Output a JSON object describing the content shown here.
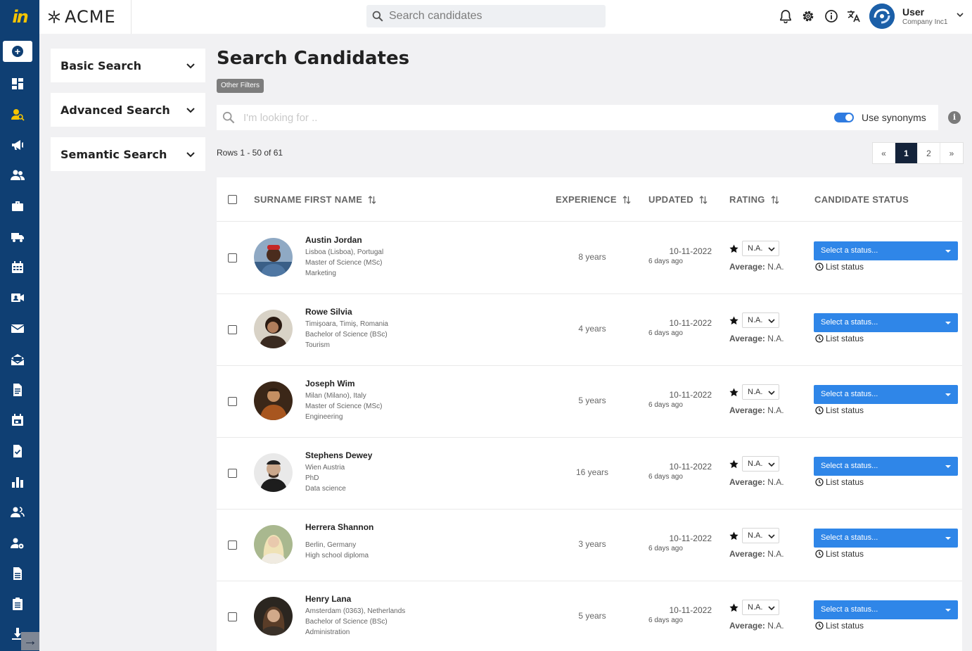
{
  "app": {
    "logo_text": "in",
    "brand": "ACME"
  },
  "header": {
    "search_placeholder": "Search candidates",
    "user_name": "User",
    "user_company": "Company Inc1"
  },
  "filters": [
    {
      "label": "Basic Search"
    },
    {
      "label": "Advanced Search"
    },
    {
      "label": "Semantic Search"
    }
  ],
  "main": {
    "title": "Search Candidates",
    "other_filters": "Other Filters",
    "search_placeholder": "I'm looking for ..",
    "use_synonyms": "Use synonyms",
    "info_glyph": "i",
    "rows_info": "Rows 1 - 50 of 61",
    "pager": [
      "«",
      "1",
      "2",
      "»"
    ],
    "current_page": "1"
  },
  "table": {
    "columns": {
      "name": "SURNAME FIRST NAME",
      "experience": "EXPERIENCE",
      "updated": "UPDATED",
      "rating": "RATING",
      "status": "CANDIDATE STATUS"
    },
    "rows": [
      {
        "name": "Austin Jordan",
        "lines": [
          "Lisboa (Lisboa), Portugal",
          "Master of Science (MSc)",
          "Marketing"
        ],
        "experience": "8 years",
        "updated": "10-11-2022",
        "ago": "6 days ago",
        "rating": "N.A.",
        "avg_label": "Average:",
        "avg_value": "N.A.",
        "status": "Select a status...",
        "list_status": "List status"
      },
      {
        "name": "Rowe Silvia",
        "lines": [
          "Timişoara, Timiş, Romania",
          "Bachelor of Science (BSc)",
          "Tourism"
        ],
        "experience": "4 years",
        "updated": "10-11-2022",
        "ago": "6 days ago",
        "rating": "N.A.",
        "avg_label": "Average:",
        "avg_value": "N.A.",
        "status": "Select a status...",
        "list_status": "List status"
      },
      {
        "name": "Joseph Wim",
        "lines": [
          "Milan (Milano), Italy",
          "Master of Science (MSc)",
          "Engineering"
        ],
        "experience": "5 years",
        "updated": "10-11-2022",
        "ago": "6 days ago",
        "rating": "N.A.",
        "avg_label": "Average:",
        "avg_value": "N.A.",
        "status": "Select a status...",
        "list_status": "List status"
      },
      {
        "name": "Stephens Dewey",
        "lines": [
          "Wien Austria",
          "PhD",
          "Data science"
        ],
        "experience": "16 years",
        "updated": "10-11-2022",
        "ago": "6 days ago",
        "rating": "N.A.",
        "avg_label": "Average:",
        "avg_value": "N.A.",
        "status": "Select a status...",
        "list_status": "List status"
      },
      {
        "name": "Herrera Shannon",
        "lines": [
          "Berlin, Germany",
          "High school diploma"
        ],
        "experience": "3 years",
        "updated": "10-11-2022",
        "ago": "6 days ago",
        "rating": "N.A.",
        "avg_label": "Average:",
        "avg_value": "N.A.",
        "status": "Select a status...",
        "list_status": "List status"
      },
      {
        "name": "Henry Lana",
        "lines": [
          "Amsterdam (0363), Netherlands",
          "Bachelor of Science (BSc)",
          "Administration"
        ],
        "experience": "5 years",
        "updated": "10-11-2022",
        "ago": "6 days ago",
        "rating": "N.A.",
        "avg_label": "Average:",
        "avg_value": "N.A.",
        "status": "Select a status...",
        "list_status": "List status"
      }
    ]
  },
  "colors": {
    "rail": "#0f3f73",
    "accent": "#2f86e8",
    "pager_active": "#14233a"
  }
}
